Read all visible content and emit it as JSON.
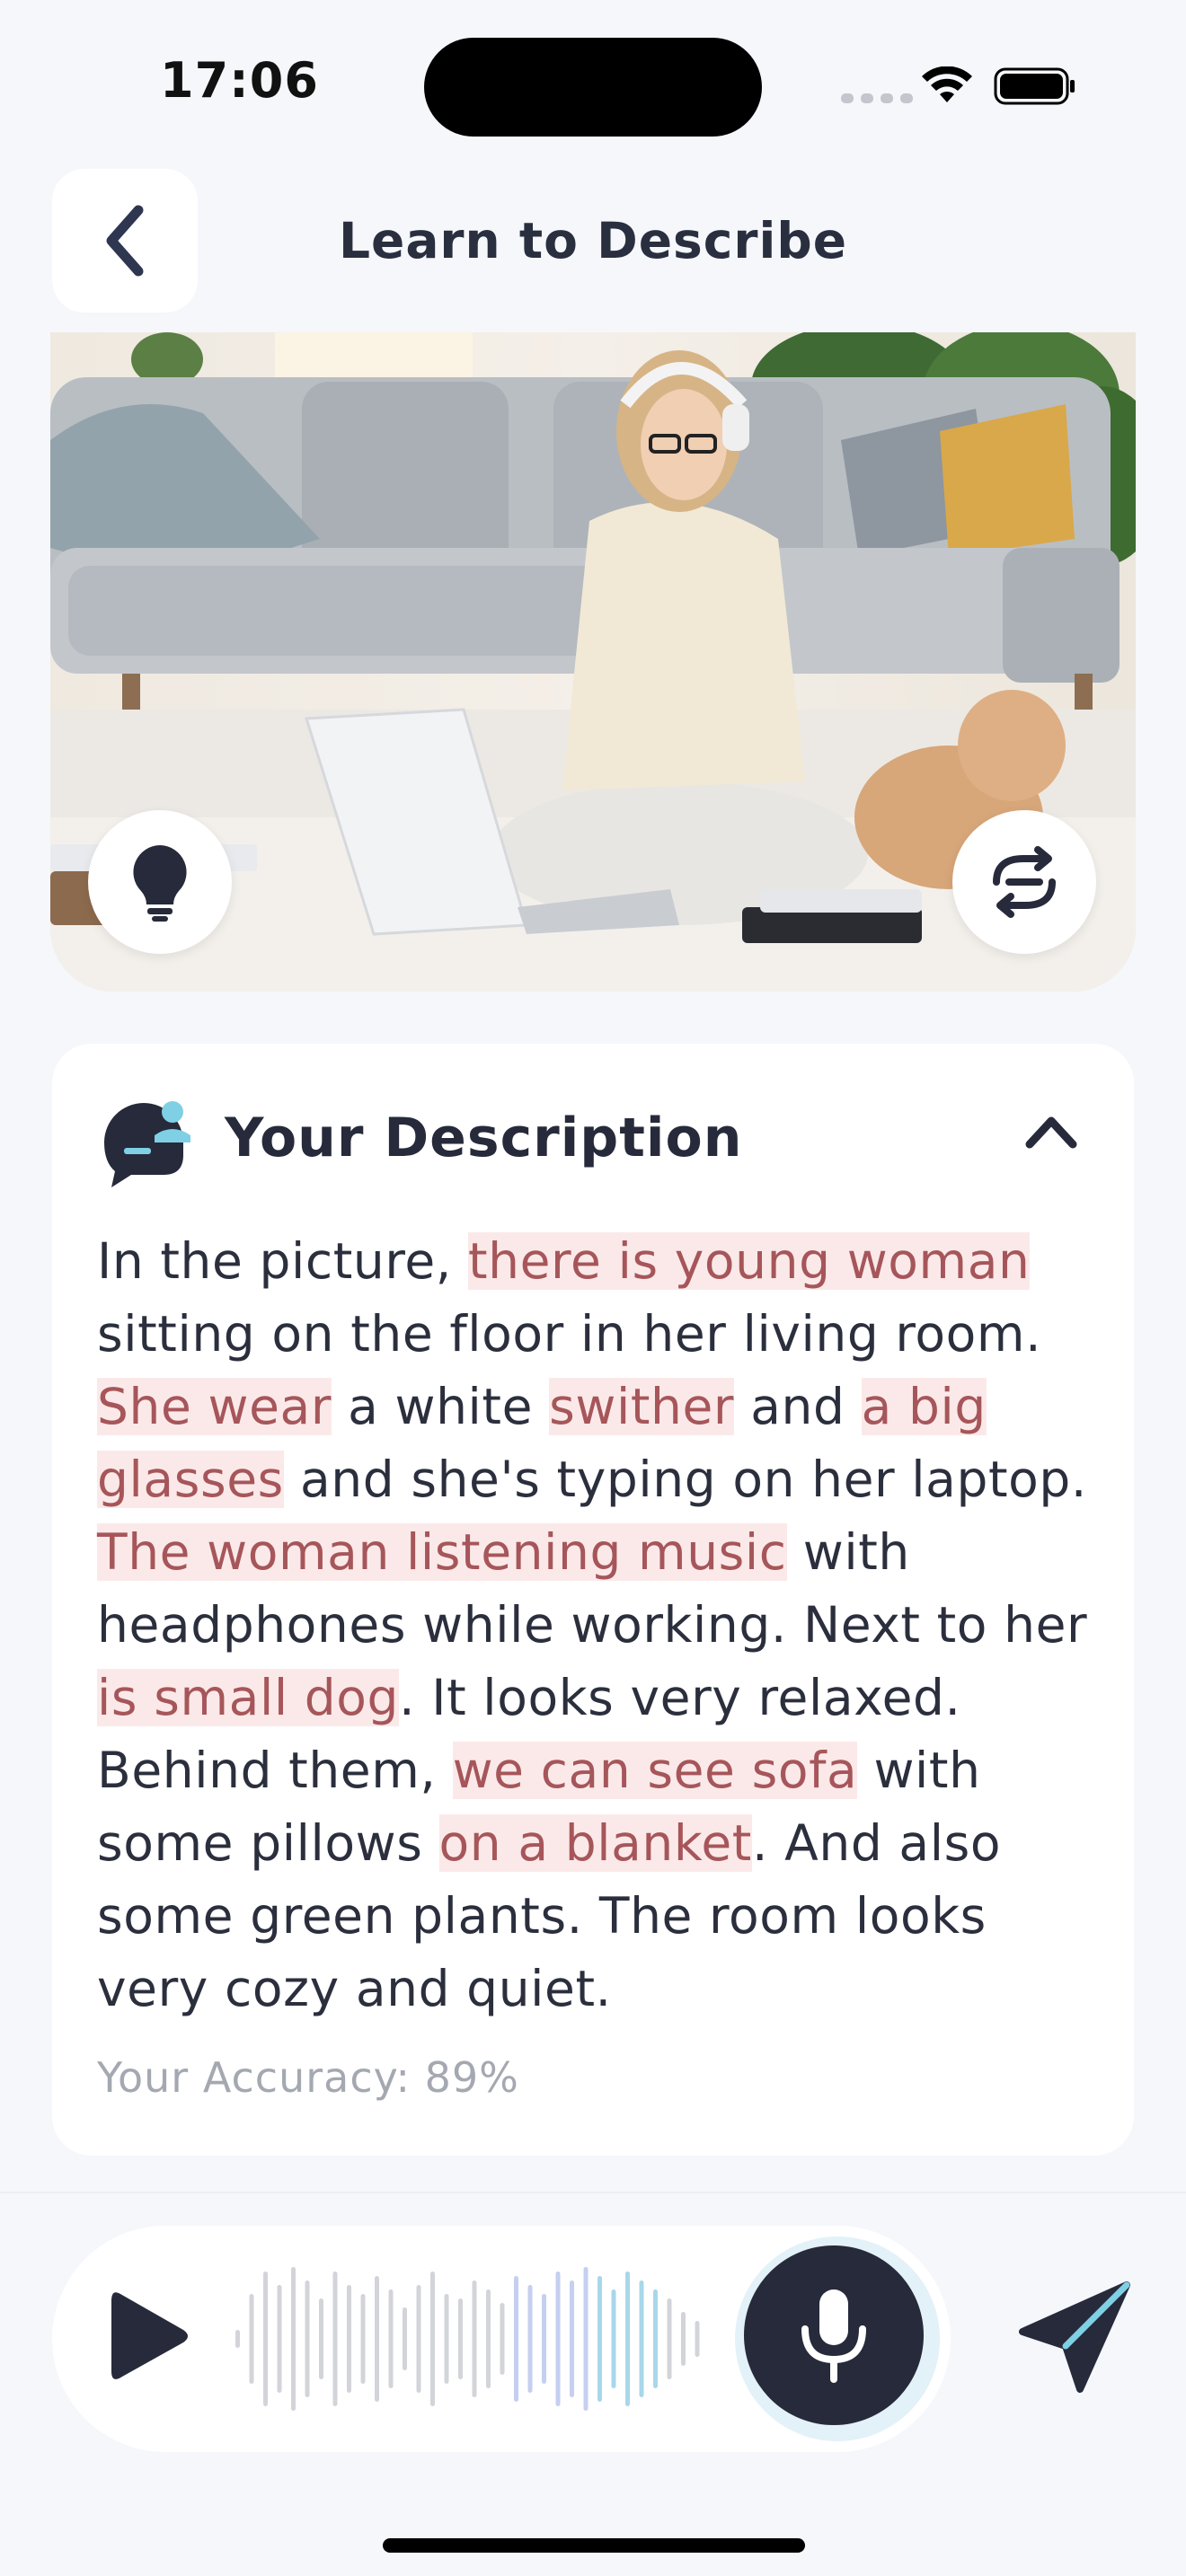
{
  "status_bar": {
    "time": "17:06"
  },
  "header": {
    "title": "Learn to Describe"
  },
  "photo": {
    "alt": ""
  },
  "description": {
    "title": "Your Description",
    "segments": [
      {
        "text": "In the picture, ",
        "error": false
      },
      {
        "text": "there is young woman",
        "error": true
      },
      {
        "text": " sitting on the floor in her living room. ",
        "error": false
      },
      {
        "text": "She wear",
        "error": true
      },
      {
        "text": " a white ",
        "error": false
      },
      {
        "text": "swither",
        "error": true
      },
      {
        "text": " and ",
        "error": false
      },
      {
        "text": "a big glasses",
        "error": true
      },
      {
        "text": " and she's typing on her laptop. ",
        "error": false
      },
      {
        "text": "The woman listening music",
        "error": true
      },
      {
        "text": " with headphones while working. Next to her ",
        "error": false
      },
      {
        "text": "is small dog",
        "error": true
      },
      {
        "text": ". It looks very relaxed. Behind them, ",
        "error": false
      },
      {
        "text": "we can see sofa",
        "error": true
      },
      {
        "text": " with some pillows ",
        "error": false
      },
      {
        "text": "on a blanket",
        "error": true
      },
      {
        "text": ". And also some green plants. The room looks very cozy and quiet.",
        "error": false
      }
    ],
    "accuracy_text": "Your Accuracy: 89%"
  },
  "recorder": {
    "icons": [
      "play-icon",
      "microphone-icon",
      "send-icon"
    ]
  },
  "colors": {
    "accent_dark": "#262a3a",
    "error_bg": "#fbe9e9",
    "error_text": "#a6565a",
    "accent_light": "#7fd0e4"
  }
}
